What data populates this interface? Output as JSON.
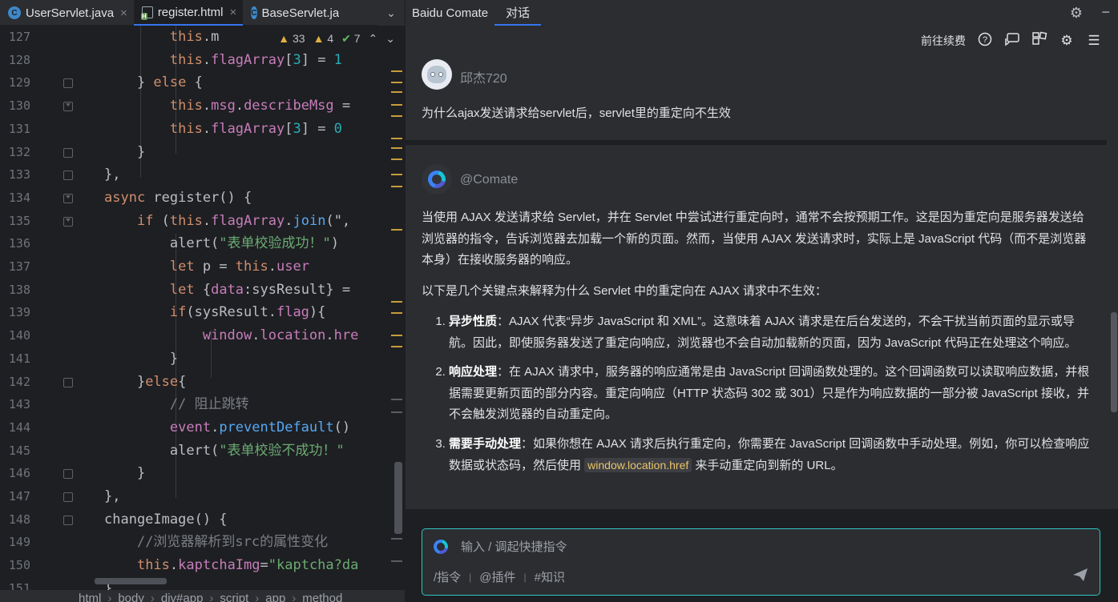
{
  "editor_tabs": [
    {
      "icon": "java-class-icon",
      "label": "UserServlet.java",
      "active": false
    },
    {
      "icon": "html-file-icon",
      "label": "register.html",
      "active": true
    },
    {
      "icon": "java-class-icon",
      "label": "BaseServlet.ja",
      "active": false
    }
  ],
  "tab_close_glyph": "×",
  "tab_overflow_glyph": "⌄",
  "inspections": {
    "warnings": "33",
    "weak_warnings": "4",
    "typos": "7"
  },
  "editor": {
    "line_numbers": [
      "127",
      "128",
      "129",
      "130",
      "131",
      "132",
      "133",
      "134",
      "135",
      "136",
      "137",
      "138",
      "139",
      "140",
      "141",
      "142",
      "143",
      "144",
      "145",
      "146",
      "147",
      "148",
      "149",
      "150",
      "151"
    ],
    "lines": [
      [
        {
          "t": "        "
        },
        {
          "t": "this",
          "c": "kw"
        },
        {
          "t": ".m"
        }
      ],
      [
        {
          "t": "        "
        },
        {
          "t": "this",
          "c": "kw"
        },
        {
          "t": "."
        },
        {
          "t": "flagArray",
          "c": "pr"
        },
        {
          "t": "["
        },
        {
          "t": "3",
          "c": "num"
        },
        {
          "t": "] = "
        },
        {
          "t": "1",
          "c": "num"
        }
      ],
      [
        {
          "t": "    } "
        },
        {
          "t": "else",
          "c": "kw"
        },
        {
          "t": " {"
        }
      ],
      [
        {
          "t": "        "
        },
        {
          "t": "this",
          "c": "kw"
        },
        {
          "t": "."
        },
        {
          "t": "msg",
          "c": "pr"
        },
        {
          "t": "."
        },
        {
          "t": "describeMsg",
          "c": "pr"
        },
        {
          "t": " ="
        }
      ],
      [
        {
          "t": "        "
        },
        {
          "t": "this",
          "c": "kw"
        },
        {
          "t": "."
        },
        {
          "t": "flagArray",
          "c": "pr"
        },
        {
          "t": "["
        },
        {
          "t": "3",
          "c": "num"
        },
        {
          "t": "] = "
        },
        {
          "t": "0",
          "c": "num"
        }
      ],
      [
        {
          "t": "    }"
        }
      ],
      [
        {
          "t": "},"
        }
      ],
      [
        {
          "t": "async",
          "c": "kw"
        },
        {
          "t": " register() {"
        }
      ],
      [
        {
          "t": "    "
        },
        {
          "t": "if",
          "c": "kw"
        },
        {
          "t": " ("
        },
        {
          "t": "this",
          "c": "kw"
        },
        {
          "t": "."
        },
        {
          "t": "flagArray",
          "c": "pr"
        },
        {
          "t": "."
        },
        {
          "t": "join",
          "c": "fn"
        },
        {
          "t": "(\",",
          "c": "def"
        }
      ],
      [
        {
          "t": "        alert("
        },
        {
          "t": "\"表单校验成功！\"",
          "c": "str"
        },
        {
          "t": ")"
        }
      ],
      [
        {
          "t": "        "
        },
        {
          "t": "let",
          "c": "kw"
        },
        {
          "t": " p = "
        },
        {
          "t": "this",
          "c": "kw"
        },
        {
          "t": "."
        },
        {
          "t": "user",
          "c": "pr"
        }
      ],
      [
        {
          "t": "        "
        },
        {
          "t": "let",
          "c": "kw"
        },
        {
          "t": " {"
        },
        {
          "t": "data",
          "c": "pr"
        },
        {
          "t": ":sysResult} ="
        }
      ],
      [
        {
          "t": "        "
        },
        {
          "t": "if",
          "c": "kw"
        },
        {
          "t": "(sysResult."
        },
        {
          "t": "flag",
          "c": "pr"
        },
        {
          "t": "){"
        }
      ],
      [
        {
          "t": "            "
        },
        {
          "t": "window",
          "c": "pr"
        },
        {
          "t": "."
        },
        {
          "t": "location",
          "c": "pr"
        },
        {
          "t": "."
        },
        {
          "t": "hre",
          "c": "pr"
        }
      ],
      [
        {
          "t": "        }"
        }
      ],
      [
        {
          "t": "    }"
        },
        {
          "t": "else",
          "c": "kw"
        },
        {
          "t": "{"
        }
      ],
      [
        {
          "t": "        "
        },
        {
          "t": "// 阻止跳转",
          "c": "cm"
        }
      ],
      [
        {
          "t": "        "
        },
        {
          "t": "event",
          "c": "pr"
        },
        {
          "t": "."
        },
        {
          "t": "preventDefault",
          "c": "fn"
        },
        {
          "t": "()"
        }
      ],
      [
        {
          "t": "        alert("
        },
        {
          "t": "\"表单校验不成功！\"",
          "c": "str"
        }
      ],
      [
        {
          "t": "    }"
        }
      ],
      [
        {
          "t": "},"
        }
      ],
      [
        {
          "t": "changeImage() {"
        }
      ],
      [
        {
          "t": "    "
        },
        {
          "t": "//浏览器解析到src的属性变化",
          "c": "cm"
        }
      ],
      [
        {
          "t": "    "
        },
        {
          "t": "this",
          "c": "kw"
        },
        {
          "t": "."
        },
        {
          "t": "kaptchaImg",
          "c": "pr"
        },
        {
          "t": "="
        },
        {
          "t": "\"kaptcha?da",
          "c": "str"
        }
      ],
      [
        {
          "t": "}"
        }
      ]
    ]
  },
  "breadcrumb": [
    "html",
    "body",
    "div#app",
    "script",
    "app",
    "method"
  ],
  "panel": {
    "tabs": [
      {
        "label": "Baidu Comate",
        "active": false
      },
      {
        "label": "对话",
        "active": true
      }
    ],
    "toolbar": {
      "link": "前往续费"
    },
    "user": {
      "name": "邱杰720",
      "message": "为什么ajax发送请求给servlet后，servlet里的重定向不生效"
    },
    "ai": {
      "name": "@Comate",
      "intro": "当使用 AJAX 发送请求给 Servlet，并在 Servlet 中尝试进行重定向时，通常不会按预期工作。这是因为重定向是服务器发送给浏览器的指令，告诉浏览器去加载一个新的页面。然而，当使用 AJAX 发送请求时，实际上是 JavaScript 代码（而不是浏览器本身）在接收服务器的响应。",
      "lead": "以下是几个关键点来解释为什么 Servlet 中的重定向在 AJAX 请求中不生效：",
      "points": [
        {
          "title": "异步性质",
          "text": "：AJAX 代表“异步 JavaScript 和 XML”。这意味着 AJAX 请求是在后台发送的，不会干扰当前页面的显示或导航。因此，即使服务器发送了重定向响应，浏览器也不会自动加载新的页面，因为 JavaScript 代码正在处理这个响应。"
        },
        {
          "title": "响应处理",
          "text": "：在 AJAX 请求中，服务器的响应通常是由 JavaScript 回调函数处理的。这个回调函数可以读取响应数据，并根据需要更新页面的部分内容。重定向响应（HTTP 状态码 302 或 301）只是作为响应数据的一部分被 JavaScript 接收，并不会触发浏览器的自动重定向。"
        },
        {
          "title": "需要手动处理",
          "text": "：如果你想在 AJAX 请求后执行重定向，你需要在 JavaScript 回调函数中手动处理。例如，你可以检查响应数据或状态码，然后使用 ",
          "code": "window.location.href",
          "tail": " 来手动重定向到新的 URL。"
        }
      ]
    },
    "input": {
      "placeholder": "输入 / 调起快捷指令",
      "shortcuts": [
        "/指令",
        "@插件",
        "#知识"
      ]
    }
  }
}
